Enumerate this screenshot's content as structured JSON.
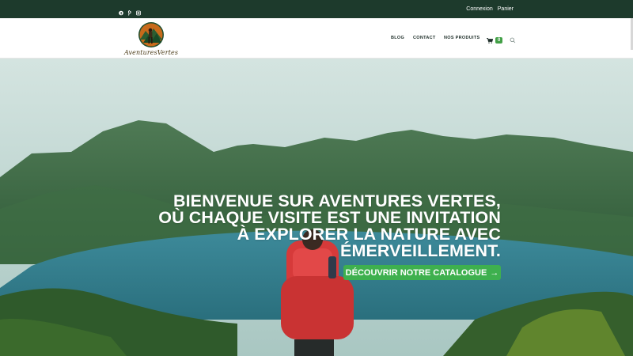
{
  "topbar": {
    "social": [
      "facebook-icon",
      "pinterest-icon",
      "instagram-icon"
    ],
    "links": {
      "login": "Connexion",
      "cart": "Panier"
    },
    "bg_color": "#1d3a2c"
  },
  "brand": {
    "name": "AventuresVertes"
  },
  "nav": {
    "items": [
      "BLOG",
      "CONTACT",
      "NOS PRODUITS"
    ],
    "cart_count": "0",
    "icons": {
      "cart": "cart-icon",
      "search": "search-icon"
    }
  },
  "hero": {
    "headline": "BIENVENUE SUR AVENTURES VERTES, OÙ CHAQUE VISITE EST UNE INVITATION À EXPLORER LA NATURE AVEC ÉMERVEILLEMENT.",
    "cta_label": "DÉCOUVRIR NOTRE CATALOGUE",
    "cta_arrow": "→",
    "cta_color": "#3eb04e"
  }
}
